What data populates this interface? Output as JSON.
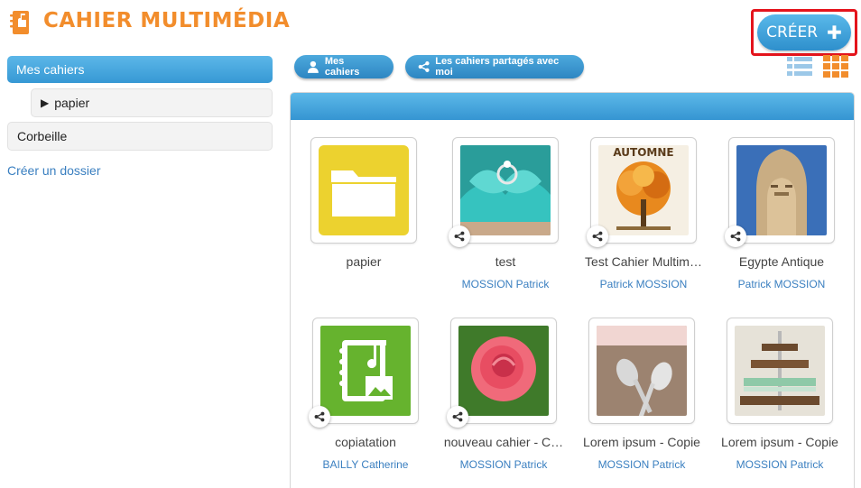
{
  "header": {
    "title": "CAHIER MULTIMÉDIA",
    "logo_icon": "notebook-icon",
    "create_label": "CRÉER",
    "create_icon": "plus-icon",
    "accent": "#f28d2c",
    "blue": "#3595d2",
    "highlight": "#e4141c"
  },
  "sidebar": {
    "items": [
      {
        "label": "Mes cahiers",
        "active": true
      },
      {
        "label": "papier",
        "icon": "triangle-right-icon"
      },
      {
        "label": "Corbeille"
      }
    ],
    "create_folder": "Créer un dossier"
  },
  "tabs": [
    {
      "label": "Mes cahiers",
      "icon": "user-icon"
    },
    {
      "label": "Les cahiers partagés avec moi",
      "icon": "share-icon"
    }
  ],
  "view_toggles": [
    {
      "icon": "list-view-icon",
      "active": false
    },
    {
      "icon": "grid-view-icon",
      "active": true
    }
  ],
  "cards": [
    {
      "title": "papier",
      "author": "",
      "type": "folder",
      "shared": false
    },
    {
      "title": "test",
      "author": "MOSSION Patrick",
      "type": "cupcake",
      "shared": true
    },
    {
      "title": "Test Cahier Multim…",
      "author": "Patrick MOSSION",
      "type": "automne",
      "shared": true,
      "image_text": "AUTOMNE"
    },
    {
      "title": "Egypte Antique",
      "author": "Patrick MOSSION",
      "type": "egypt",
      "shared": true
    },
    {
      "title": "copiatation",
      "author": "BAILLY Catherine",
      "type": "multimedia",
      "shared": true
    },
    {
      "title": "nouveau cahier - C…",
      "author": "MOSSION Patrick",
      "type": "rose",
      "shared": true
    },
    {
      "title": "Lorem ipsum - Copie",
      "author": "MOSSION Patrick",
      "type": "spoons",
      "shared": false
    },
    {
      "title": "Lorem ipsum - Copie",
      "author": "MOSSION Patrick",
      "type": "cupcake-tower",
      "shared": false
    }
  ]
}
